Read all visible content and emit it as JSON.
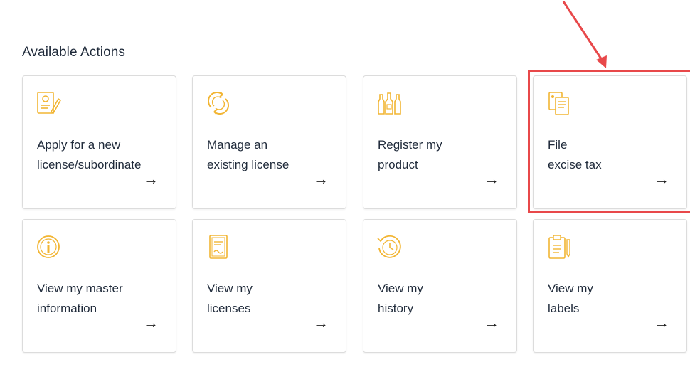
{
  "section": {
    "title": "Available Actions"
  },
  "cards": [
    {
      "line1": "Apply for a new",
      "line2": "license/subordinate",
      "arrow": "→",
      "icon": "license-application-icon"
    },
    {
      "line1": "Manage an",
      "line2": "existing license",
      "arrow": "→",
      "icon": "refresh-cycle-icon"
    },
    {
      "line1": "Register my",
      "line2": "product",
      "arrow": "→",
      "icon": "bottles-icon"
    },
    {
      "line1": "File",
      "line2": "excise tax",
      "arrow": "→",
      "icon": "tax-document-icon"
    },
    {
      "line1": "View my master",
      "line2": "information",
      "arrow": "→",
      "icon": "info-icon"
    },
    {
      "line1": "View my",
      "line2": "licenses",
      "arrow": "→",
      "icon": "license-certificate-icon"
    },
    {
      "line1": "View my",
      "line2": "history",
      "arrow": "→",
      "icon": "history-clock-icon"
    },
    {
      "line1": "View my",
      "line2": "labels",
      "arrow": "→",
      "icon": "label-clipboard-icon"
    }
  ],
  "colors": {
    "icon": "#f2b533",
    "highlight": "#e8484a",
    "text": "#1f2a3a"
  }
}
